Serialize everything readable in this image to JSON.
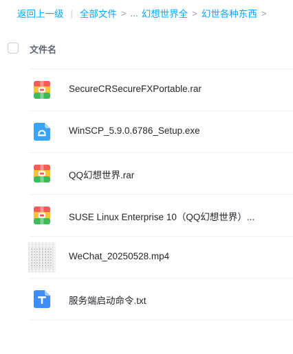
{
  "breadcrumb": {
    "back": "返回上一级",
    "divider": "|",
    "root": "全部文件",
    "ellipsis": "...",
    "level1": "幻想世界全",
    "level2": "幻世各种东西",
    "separator": ">"
  },
  "header": {
    "column_name": "文件名"
  },
  "files": [
    {
      "name": "SecureCRSecureFXPortable.rar",
      "icon": "archive-icon"
    },
    {
      "name": "WinSCP_5.9.0.6786_Setup.exe",
      "icon": "exe-icon"
    },
    {
      "name": "QQ幻想世界.rar",
      "icon": "archive-icon"
    },
    {
      "name": "SUSE Linux Enterprise 10（QQ幻想世界）...",
      "icon": "archive-icon"
    },
    {
      "name": "WeChat_20250528.mp4",
      "icon": "video-thumbnail"
    },
    {
      "name": "服务端启动命令.txt",
      "icon": "text-icon"
    }
  ],
  "colors": {
    "accent": "#06a7ff",
    "archive_top": "#f25c54",
    "archive_mid": "#f9c339",
    "archive_bottom": "#3dbb5b",
    "exe_blue": "#3aa4f8",
    "txt_blue": "#3d8ef7"
  }
}
